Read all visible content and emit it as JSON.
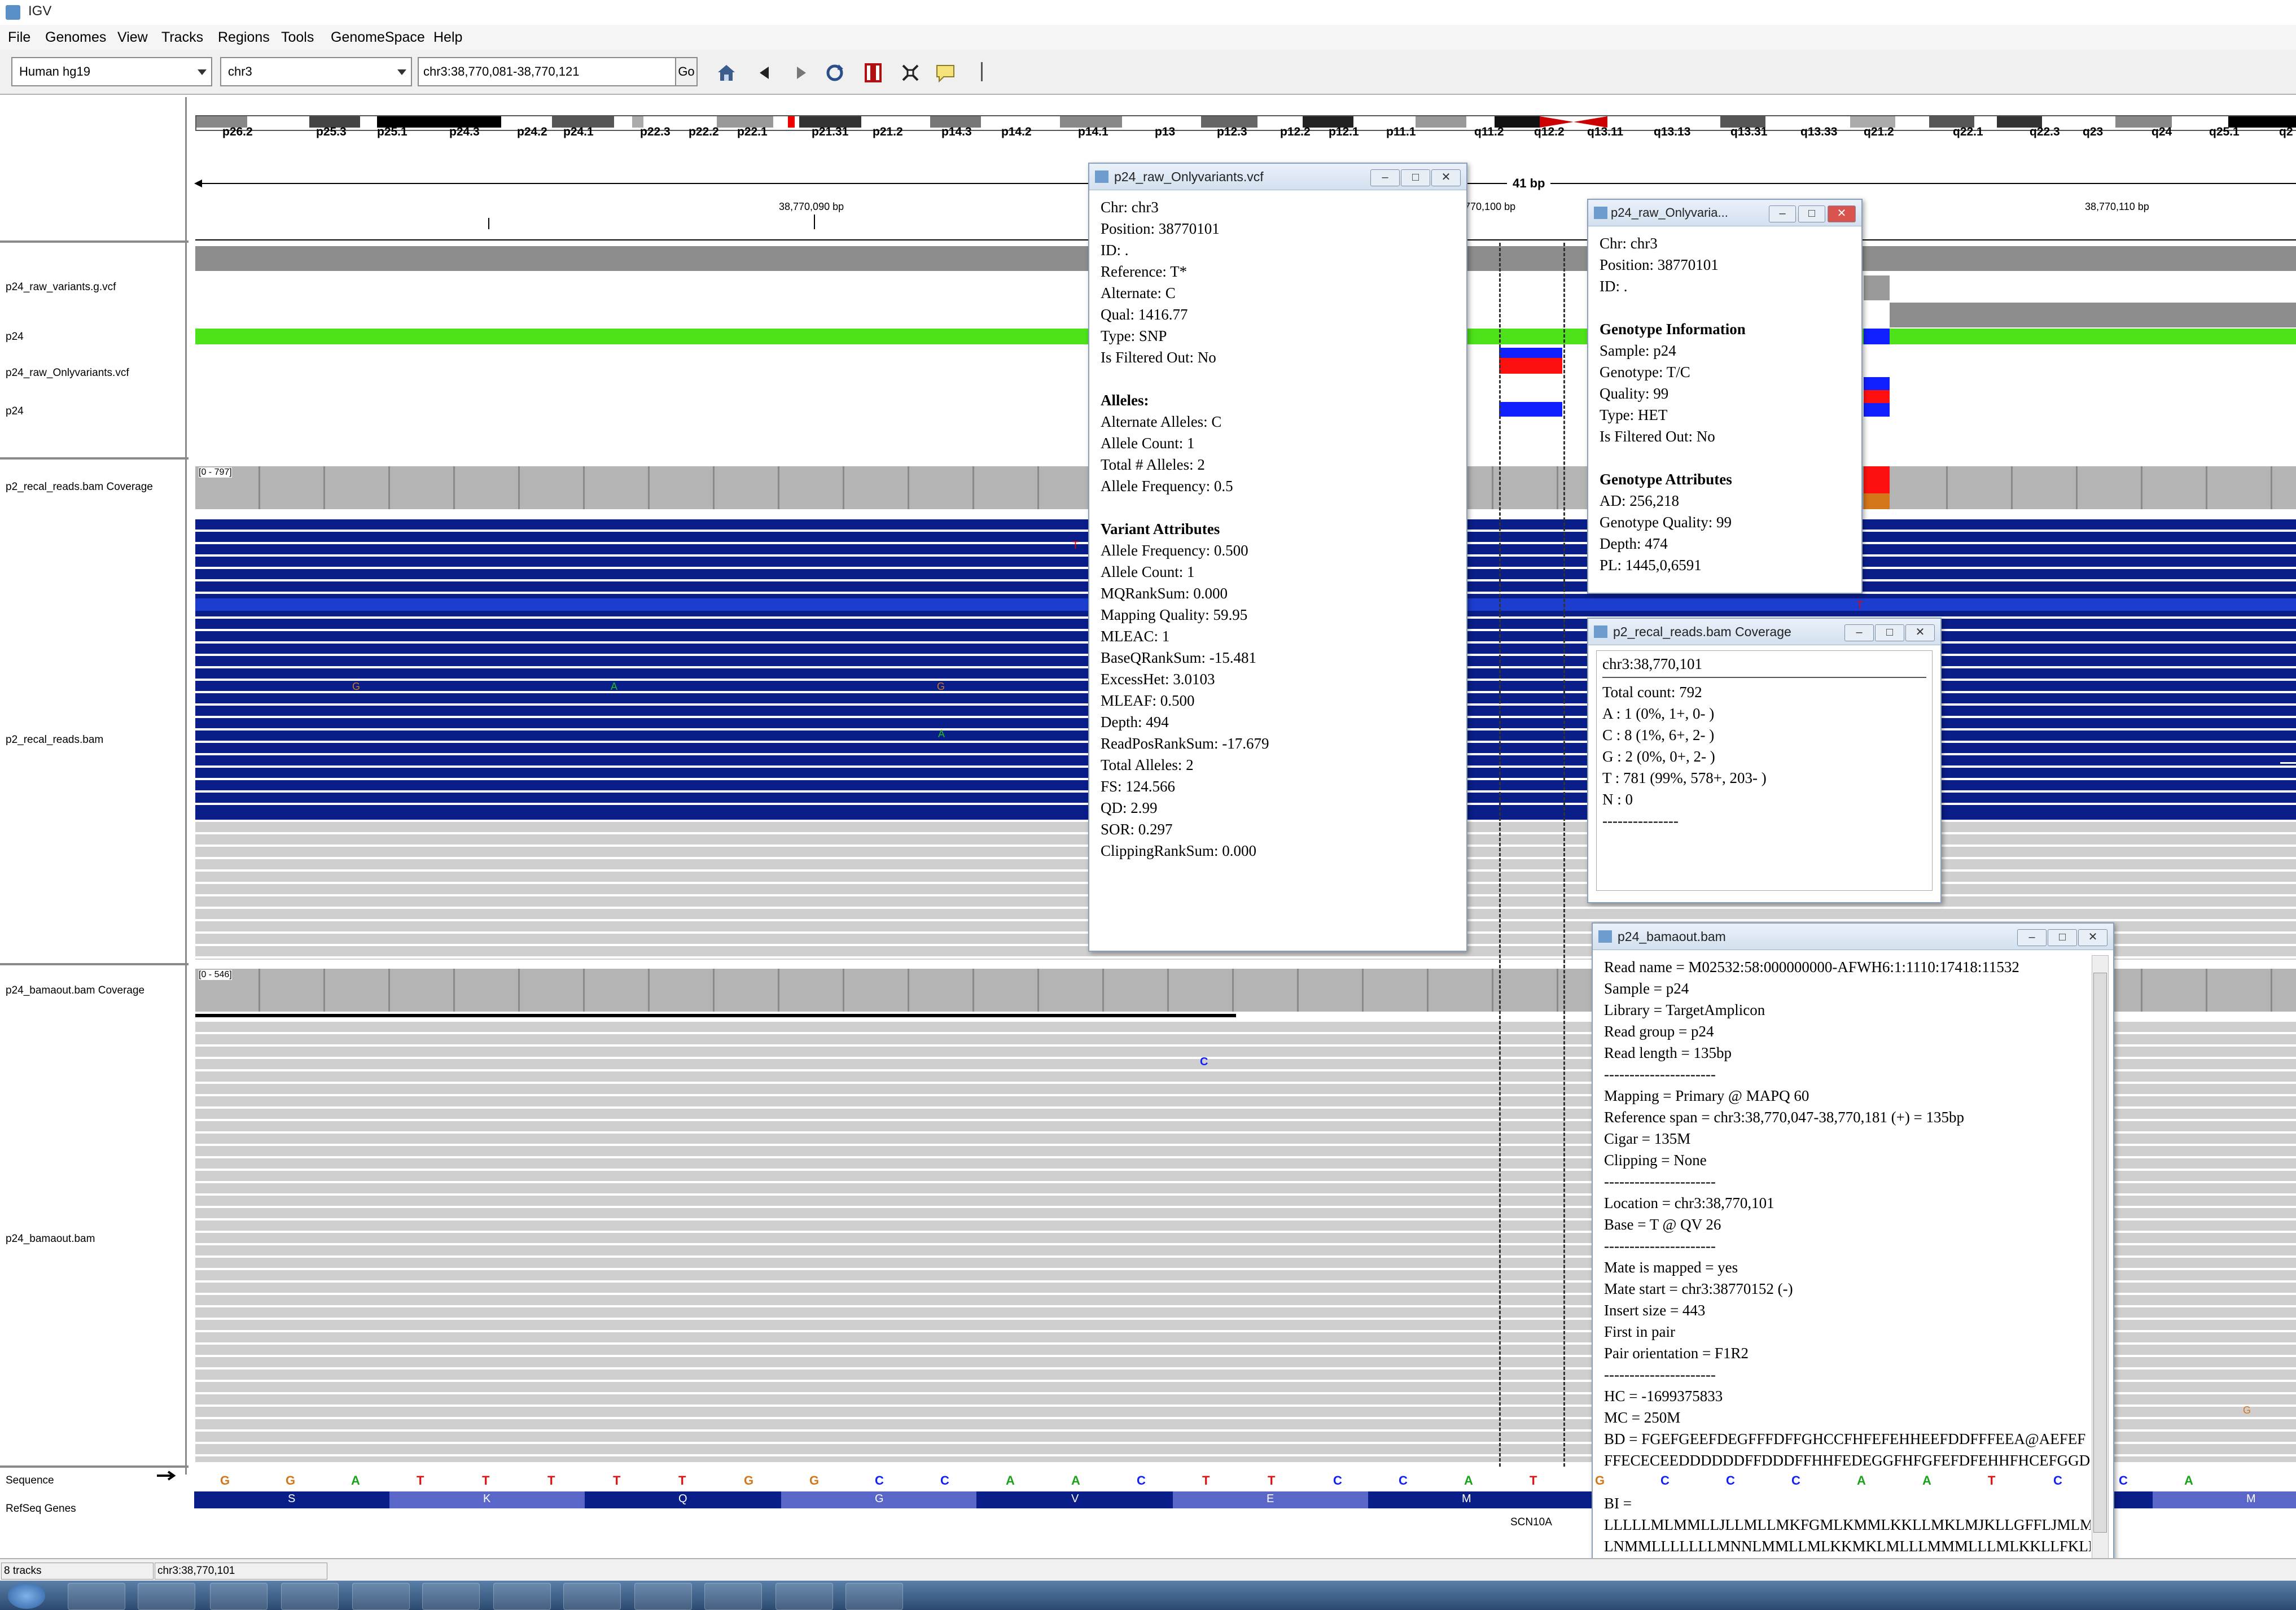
{
  "window": {
    "title": "IGV"
  },
  "menu": [
    "File",
    "Genomes",
    "View",
    "Tracks",
    "Regions",
    "Tools",
    "GenomeSpace",
    "Help"
  ],
  "toolbar": {
    "genome": "Human hg19",
    "chromosome": "chr3",
    "locus": "chr3:38,770,081-38,770,121",
    "go_label": "Go",
    "icons": [
      "home-icon",
      "back-icon",
      "forward-icon",
      "refresh-icon",
      "roi-icon",
      "resize-icon",
      "popup-info-icon"
    ]
  },
  "ideogram": {
    "bands": [
      "p26.2",
      "p25.3",
      "p25.1",
      "p24.3",
      "p24.2",
      "p24.1",
      "p22.3",
      "p22.2",
      "p22.1",
      "p21.31",
      "p21.2",
      "p14.3",
      "p14.2",
      "p14.1",
      "p13",
      "p12.3",
      "p12.2",
      "p12.1",
      "p11.1",
      "q11.2",
      "q12.2",
      "q13.11",
      "q13.13",
      "q13.31",
      "q13.33",
      "q21.2",
      "q22.1",
      "q22.3",
      "q23",
      "q24",
      "q25.1",
      "q2"
    ]
  },
  "ruler": {
    "span": "41 bp",
    "ticks": [
      "38,770,090 bp",
      "38,770,100 bp",
      "38,770,110 bp"
    ]
  },
  "tracks": {
    "names": [
      "p24_raw_variants.g.vcf",
      "p24",
      "p24_raw_Onlyvariants.vcf",
      "p24",
      "p2_recal_reads.bam Coverage",
      "p2_recal_reads.bam",
      "p24_bamaout.bam Coverage",
      "p24_bamaout.bam",
      "Sequence",
      "RefSeq Genes"
    ],
    "coverage1_range": "[0 - 797]",
    "coverage2_range": "[0 - 546]",
    "mismatch_bases": [
      "T",
      "G",
      "A",
      "G",
      "A",
      "C",
      "T",
      "G"
    ],
    "sequence": [
      "G",
      "G",
      "A",
      "T",
      "T",
      "T",
      "T",
      "T",
      "G",
      "G",
      "C",
      "C",
      "A",
      "A",
      "C",
      "T",
      "T",
      "C",
      "C",
      "A",
      "T",
      "G",
      "C",
      "C",
      "C",
      "A",
      "A",
      "T",
      "C",
      "C",
      "A"
    ],
    "amino_acids": [
      "S",
      "K",
      "Q",
      "G",
      "V",
      "E",
      "M",
      "M"
    ],
    "gene": "SCN10A"
  },
  "popup_vcf": {
    "title": "p24_raw_Onlyvariants.vcf",
    "lines": [
      "Chr: chr3",
      "Position: 38770101",
      "ID: .",
      "Reference: T*",
      "Alternate: C",
      "Qual: 1416.77",
      "Type: SNP",
      "Is Filtered Out: No",
      "",
      "Alleles:",
      "Alternate Alleles: C",
      "Allele Count: 1",
      "Total # Alleles: 2",
      "Allele Frequency: 0.5",
      "",
      "Variant Attributes",
      "Allele Frequency: 0.500",
      "Allele Count: 1",
      "MQRankSum: 0.000",
      "Mapping Quality: 59.95",
      "MLEAC: 1",
      "BaseQRankSum: -15.481",
      "ExcessHet: 3.0103",
      "MLEAF: 0.500",
      "Depth: 494",
      "ReadPosRankSum: -17.679",
      "Total Alleles: 2",
      "FS: 124.566",
      "QD: 2.99",
      "SOR: 0.297",
      "ClippingRankSum: 0.000"
    ]
  },
  "popup_genotype": {
    "title": "p24_raw_Onlyvaria...",
    "lines": [
      "Chr: chr3",
      "Position: 38770101",
      "ID: .",
      "",
      "Genotype Information",
      "Sample: p24",
      "Genotype: T/C",
      "Quality: 99",
      "Type: HET",
      "Is Filtered Out: No",
      "",
      "Genotype Attributes",
      "AD: 256,218",
      "Genotype Quality: 99",
      "Depth: 474",
      "PL: 1445,0,6591"
    ]
  },
  "popup_coverage": {
    "title": "p2_recal_reads.bam Coverage",
    "header": "chr3:38,770,101",
    "lines": [
      "Total count: 792",
      "A : 1 (0%, 1+, 0- )",
      "C : 8 (1%, 6+, 2- )",
      "G : 2 (0%, 0+, 2- )",
      "T : 781 (99%, 578+, 203- )",
      "N : 0",
      "---------------"
    ]
  },
  "popup_read": {
    "title": "p24_bamaout.bam",
    "lines": [
      "Read name = M02532:58:000000000-AFWH6:1:1110:17418:11532",
      "Sample = p24",
      "Library = TargetAmplicon",
      "Read group = p24",
      "Read length = 135bp",
      "----------------------",
      "Mapping = Primary @ MAPQ 60",
      "Reference span = chr3:38,770,047-38,770,181 (+) = 135bp",
      "Cigar = 135M",
      "Clipping = None",
      "----------------------",
      "Location = chr3:38,770,101",
      "Base = T @ QV 26",
      "----------------------",
      "Mate is mapped = yes",
      "Mate start = chr3:38770152 (-)",
      "Insert size = 443",
      "First in pair",
      "Pair orientation = F1R2",
      "----------------------",
      "HC = -1699375833",
      "MC = 250M",
      "BD = FGEFGEEFDEGFFFDFFGHCCFHFEFEHHEEFDDFFFEEA@AEFEF",
      "FFECECEEDDDDDDFFDDDFFHHFEDEGGFHFGFEFDFEHHFHCEFGGDI",
      "",
      "BI =",
      "LLLLLMLMMLLJLLMLLMKFGMLKMMLKKLLMKLMJKLLGFFLJMLM",
      "LNMMLLLLLLLMNNLMMLLMLKKMKLMLLLMMMLLLMLKKLLFKLK"
    ]
  },
  "status": {
    "tracks": "8 tracks",
    "locus": "chr3:38,770,101"
  },
  "colors": {
    "read_blue": "#0a1e8a",
    "variant_green": "#4de21a",
    "het_blue": "#1020ff",
    "het_red": "#ff1010"
  }
}
